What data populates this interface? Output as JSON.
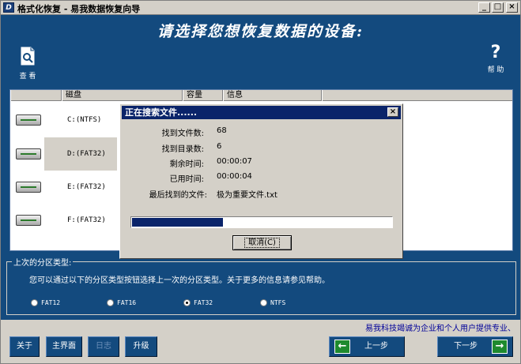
{
  "window": {
    "title": "格式化恢复 - 易我数据恢复向导",
    "icon_letter": "D"
  },
  "banner": {
    "title": "请选择您想恢复数据的设备:"
  },
  "toolbar": {
    "view_label": "查 看",
    "help_label": "帮 助",
    "help_glyph": "?"
  },
  "list": {
    "columns": [
      "磁盘",
      "容量",
      "信息"
    ],
    "rows": [
      {
        "label": "C:(NTFS)"
      },
      {
        "label": "D:(FAT32)"
      },
      {
        "label": "E:(FAT32)"
      },
      {
        "label": "F:(FAT32)"
      }
    ],
    "selected_index": 1
  },
  "dialog": {
    "title": "正在搜索文件......",
    "fields": [
      {
        "label": "找到文件数:",
        "value": "68"
      },
      {
        "label": "找到目录数:",
        "value": "6"
      },
      {
        "label": "剩余时间:",
        "value": "00:00:07"
      },
      {
        "label": "已用时间:",
        "value": "00:00:04"
      },
      {
        "label": "最后找到的文件:",
        "value": "极为重要文件.txt"
      }
    ],
    "progress_fraction": 0.35,
    "cancel_label": "取消(C)"
  },
  "partition": {
    "group_title": "上次的分区类型:",
    "description": "您可以通过以下的分区类型按钮选择上一次的分区类型。关于更多的信息请参见帮助。",
    "options": [
      "FAT12",
      "FAT16",
      "FAT32",
      "NTFS"
    ],
    "selected": "FAT32"
  },
  "footer": {
    "note": "易我科技竭诚为企业和个人用户提供专业、",
    "buttons": {
      "about": "关于",
      "home": "主界面",
      "log": "日志",
      "upgrade": "升级",
      "back": "上一步",
      "next": "下一步"
    }
  }
}
